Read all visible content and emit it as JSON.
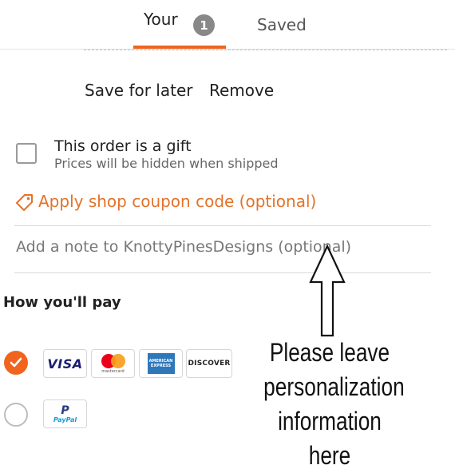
{
  "tabs": {
    "your_label": "Your",
    "your_count": "1",
    "saved_label": "Saved"
  },
  "item_actions": {
    "save_for_later": "Save for later",
    "remove": "Remove"
  },
  "gift": {
    "label": "This order is a gift",
    "sublabel": "Prices will be hidden when shipped",
    "checked": false
  },
  "coupon": {
    "label": "Apply shop coupon code (optional)",
    "icon": "tag-icon",
    "color": "#e4722a"
  },
  "note": {
    "placeholder": "Add a note to KnottyPinesDesigns (optional)",
    "value": ""
  },
  "payment": {
    "heading": "How you'll pay",
    "selected_option": "cards",
    "cards": {
      "visa": "VISA",
      "mastercard_caption": "mastercard",
      "amex_line1": "AMERICAN",
      "amex_line2": "EXPRESS",
      "discover": "DISCOVER"
    },
    "paypal": {
      "logo": "P",
      "label": "PayPal"
    }
  },
  "annotation": {
    "line1": "Please leave",
    "line2": "personalization",
    "line3": "information here"
  },
  "colors": {
    "accent": "#f1641e",
    "badge": "#888888"
  }
}
